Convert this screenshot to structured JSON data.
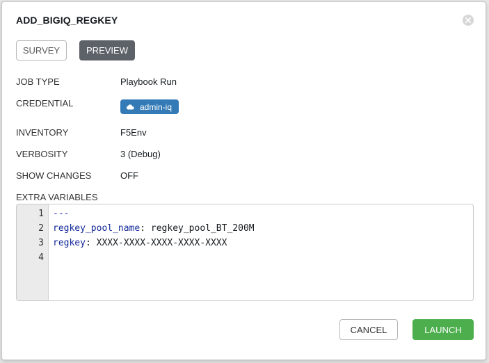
{
  "modal": {
    "title": "ADD_BIGIQ_REGKEY"
  },
  "tabs": [
    {
      "label": "SURVEY",
      "active": false
    },
    {
      "label": "PREVIEW",
      "active": true
    }
  ],
  "details": {
    "job_type": {
      "label": "JOB TYPE",
      "value": "Playbook Run"
    },
    "credential": {
      "label": "CREDENTIAL",
      "value": "admin-iq",
      "icon": "cloud-icon",
      "color": "#337ab7"
    },
    "inventory": {
      "label": "INVENTORY",
      "value": "F5Env"
    },
    "verbosity": {
      "label": "VERBOSITY",
      "value": "3 (Debug)"
    },
    "show_changes": {
      "label": "SHOW CHANGES",
      "value": "OFF"
    }
  },
  "extra_variables": {
    "label": "EXTRA VARIABLES",
    "line_numbers": [
      "1",
      "2",
      "3",
      "4"
    ],
    "lines": [
      {
        "doc_marker": "---"
      },
      {
        "key": "regkey_pool_name",
        "sep": ": ",
        "value": "regkey_pool_BT_200M"
      },
      {
        "key": "regkey",
        "sep": ": ",
        "value": "XXXX-XXXX-XXXX-XXXX-XXXX"
      },
      {
        "key": "",
        "sep": "",
        "value": ""
      }
    ]
  },
  "footer": {
    "cancel_label": "CANCEL",
    "launch_label": "LAUNCH"
  },
  "colors": {
    "launch": "#4cae4c",
    "preview_active": "#5d6168",
    "credential_pill": "#337ab7"
  }
}
